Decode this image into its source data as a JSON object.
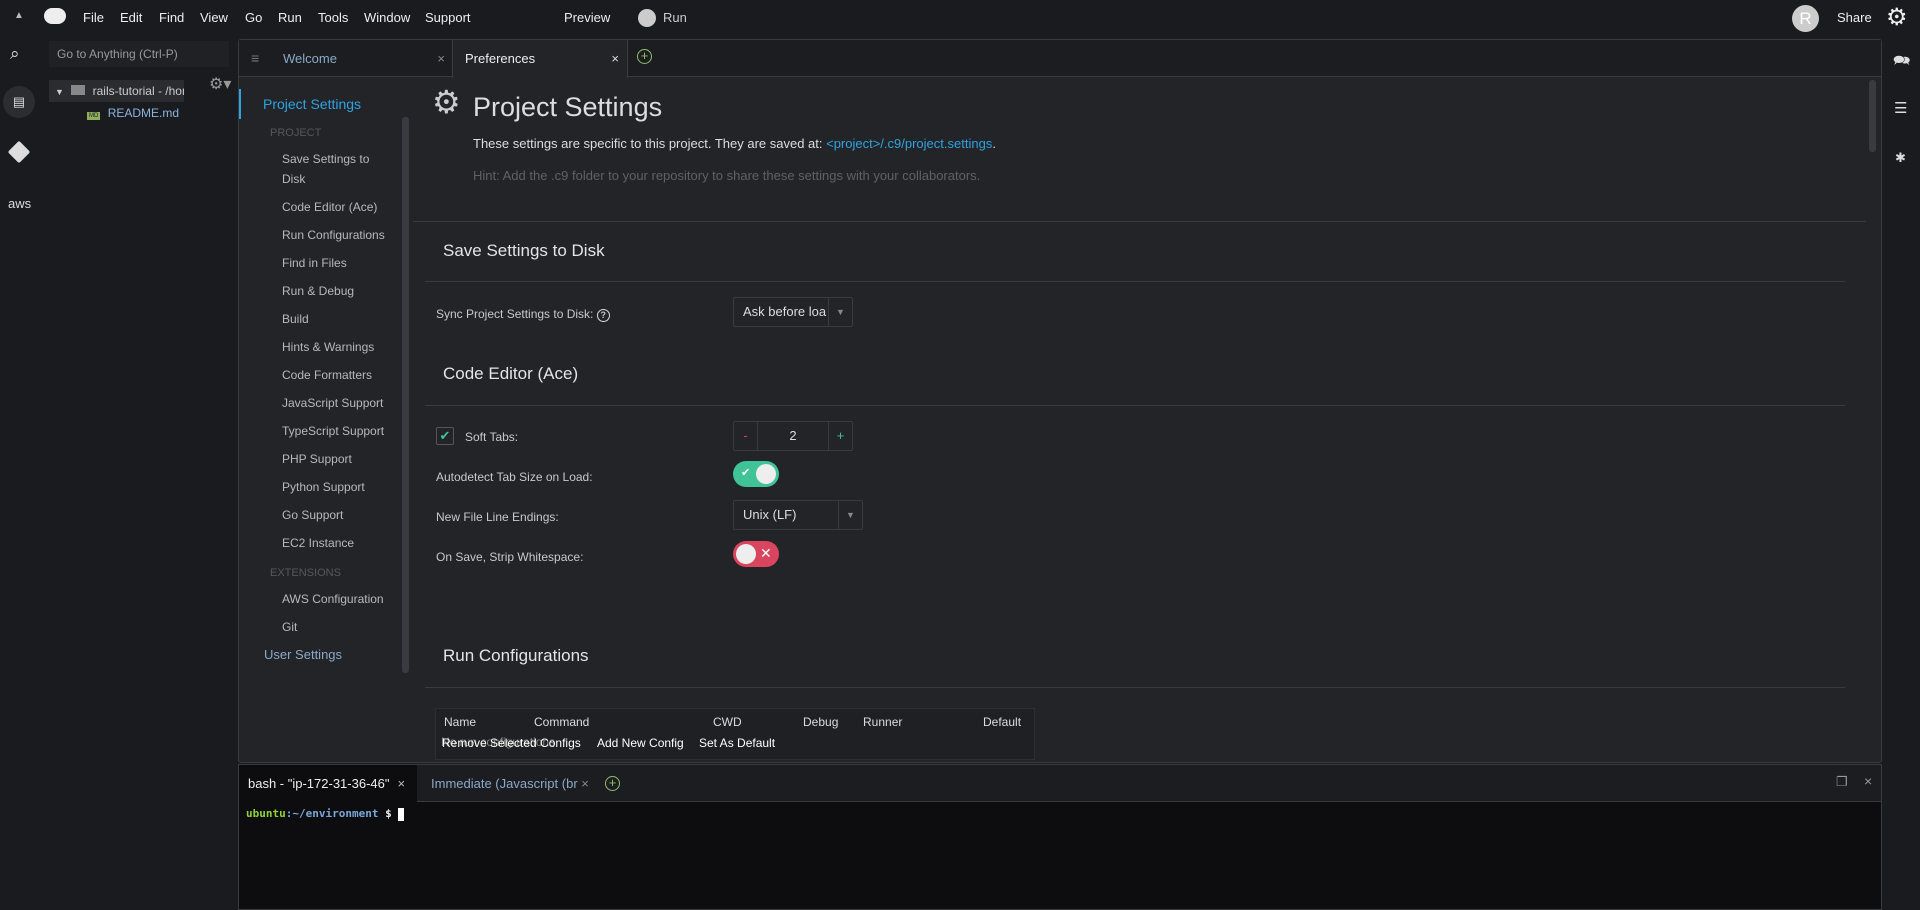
{
  "menubar": {
    "items": [
      "File",
      "Edit",
      "Find",
      "View",
      "Go",
      "Run",
      "Tools",
      "Window",
      "Support"
    ],
    "preview": "Preview",
    "run": "Run",
    "avatar": "R",
    "share": "Share"
  },
  "tree": {
    "search_placeholder": "Go to Anything (Ctrl-P)",
    "root": "rails-tutorial - /hon",
    "file": "README.md",
    "file_badge": "MD"
  },
  "leftbar": {
    "aws": "aws"
  },
  "tabs": [
    {
      "label": "Welcome"
    },
    {
      "label": "Preferences"
    }
  ],
  "nav": {
    "active": "Project Settings",
    "project_header": "PROJECT",
    "project_items": [
      "Save Settings to Disk",
      "Code Editor (Ace)",
      "Run Configurations",
      "Find in Files",
      "Run & Debug",
      "Build",
      "Hints & Warnings",
      "Code Formatters",
      "JavaScript Support",
      "TypeScript Support",
      "PHP Support",
      "Python Support",
      "Go Support",
      "EC2 Instance"
    ],
    "extensions_header": "EXTENSIONS",
    "extension_items": [
      "AWS Configuration",
      "Git"
    ],
    "user_settings": "User Settings"
  },
  "content": {
    "title": "Project Settings",
    "desc": "These settings are specific to this project. They are saved at: ",
    "desc_link": "<project>/.c9/project.settings",
    "desc_end": ".",
    "hint": "Hint: Add the .c9 folder to your repository to share these settings with your collaborators.",
    "save_section": "Save Settings to Disk",
    "sync_label": "Sync Project Settings to Disk:",
    "sync_value": "Ask before loa",
    "editor_section": "Code Editor (Ace)",
    "soft_tabs_label": "Soft Tabs:",
    "soft_tabs_checked": true,
    "tab_size": "2",
    "autodetect_label": "Autodetect Tab Size on Load:",
    "autodetect_on": true,
    "line_endings_label": "New File Line Endings:",
    "line_endings_value": "Unix (LF)",
    "strip_label": "On Save, Strip Whitespace:",
    "strip_on": false,
    "run_section": "Run Configurations",
    "run_columns": [
      "Name",
      "Command",
      "CWD",
      "Debug",
      "Runner",
      "Default"
    ],
    "run_empty": "No run configurations",
    "run_buttons": [
      "Remove Selected Configs",
      "Add New Config",
      "Set As Default"
    ]
  },
  "terminal": {
    "tabs": [
      "bash - \"ip-172-31-36-46\"",
      "Immediate (Javascript (br"
    ],
    "prompt_user": "ubuntu",
    "prompt_path": ":~/environment",
    "prompt_symbol": "$"
  },
  "colors": {
    "accent": "#2fa2e0",
    "toggle_on": "#40c497",
    "toggle_off": "#d9455f",
    "prompt_user": "#8fd13b"
  }
}
